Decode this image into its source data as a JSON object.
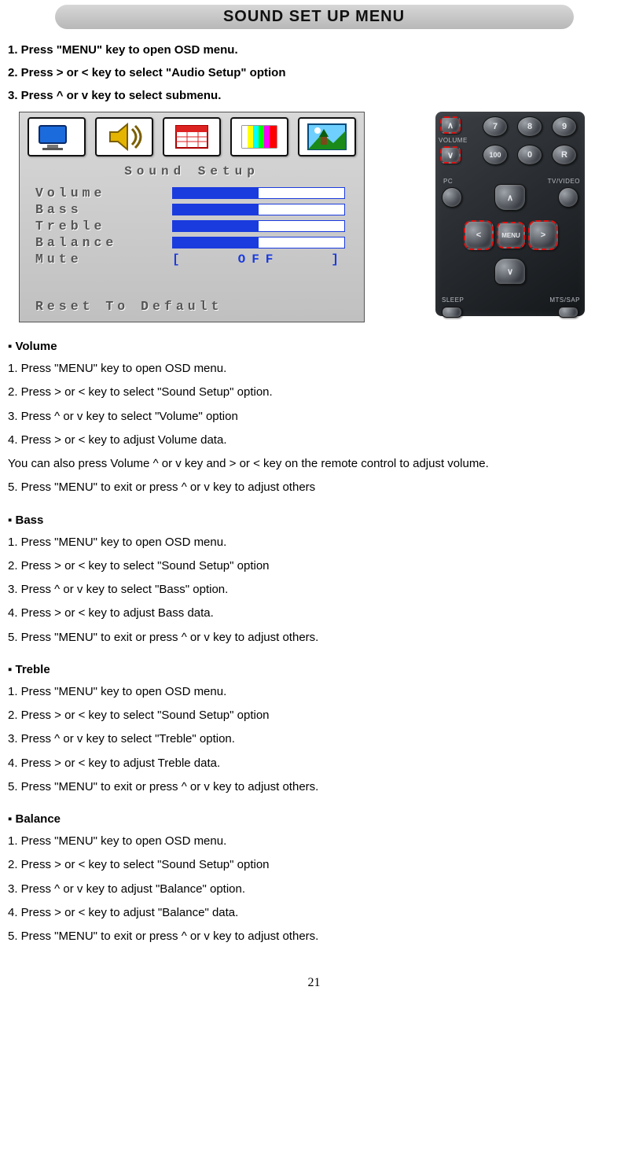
{
  "title": "SOUND SET UP MENU",
  "intro": [
    "1. Press \"MENU\" key to open OSD menu.",
    "2. Press > or < key to select \"Audio Setup\" option",
    "3. Press ^ or v key to select submenu."
  ],
  "osd": {
    "heading": "Sound  Setup",
    "rows": [
      {
        "label": "Volume"
      },
      {
        "label": "Bass"
      },
      {
        "label": "Treble"
      },
      {
        "label": "Balance"
      }
    ],
    "mute_label": "Mute",
    "mute_open": "[",
    "mute_value": "OFF",
    "mute_close": "]",
    "reset": "Reset  To  Default"
  },
  "remote": {
    "vol_label": "VOLUME",
    "k7": "7",
    "k8": "8",
    "k9": "9",
    "k100": "100",
    "k0": "0",
    "kR": "R",
    "pc": "PC",
    "tv": "TV/VIDEO",
    "menu": "MENU",
    "sleep": "SLEEP",
    "mts": "MTS/SAP"
  },
  "sections": [
    {
      "heading": "▪ Volume",
      "lines": [
        "1. Press \"MENU\" key to open OSD menu.",
        "2. Press > or < key to select \"Sound Setup\" option.",
        "3. Press ^ or v key to select \"Volume\" option",
        "4. Press > or < key to adjust Volume data.",
        "You can also press Volume ^ or v key and > or < key on the remote control to adjust volume.",
        "5. Press \"MENU\" to exit or press ^ or v key to adjust others"
      ]
    },
    {
      "heading": "▪ Bass",
      "lines": [
        "1. Press \"MENU\" key to open OSD menu.",
        "2. Press > or < key to select \"Sound Setup\" option",
        "3. Press ^ or v key to select \"Bass\" option.",
        "4. Press > or < key to adjust Bass data.",
        "5. Press \"MENU\" to exit or press ^ or v key to adjust others."
      ]
    },
    {
      "heading": "▪ Treble",
      "lines": [
        "1. Press \"MENU\" key to open OSD menu.",
        "2. Press > or < key to select \"Sound Setup\" option",
        "3. Press ^ or v key to select \"Treble\" option.",
        "4. Press > or < key to adjust Treble data.",
        "5. Press \"MENU\" to exit or press ^ or v key to adjust others."
      ]
    },
    {
      "heading": "▪ Balance",
      "lines": [
        "1. Press \"MENU\" key to open OSD menu.",
        "2. Press > or < key to select \"Sound Setup\" option",
        "3. Press ^ or v key to adjust \"Balance\" option.",
        "4. Press > or < key to adjust \"Balance\" data.",
        "5. Press \"MENU\" to exit or press ^ or v key to adjust others."
      ]
    }
  ],
  "page_number": "21"
}
